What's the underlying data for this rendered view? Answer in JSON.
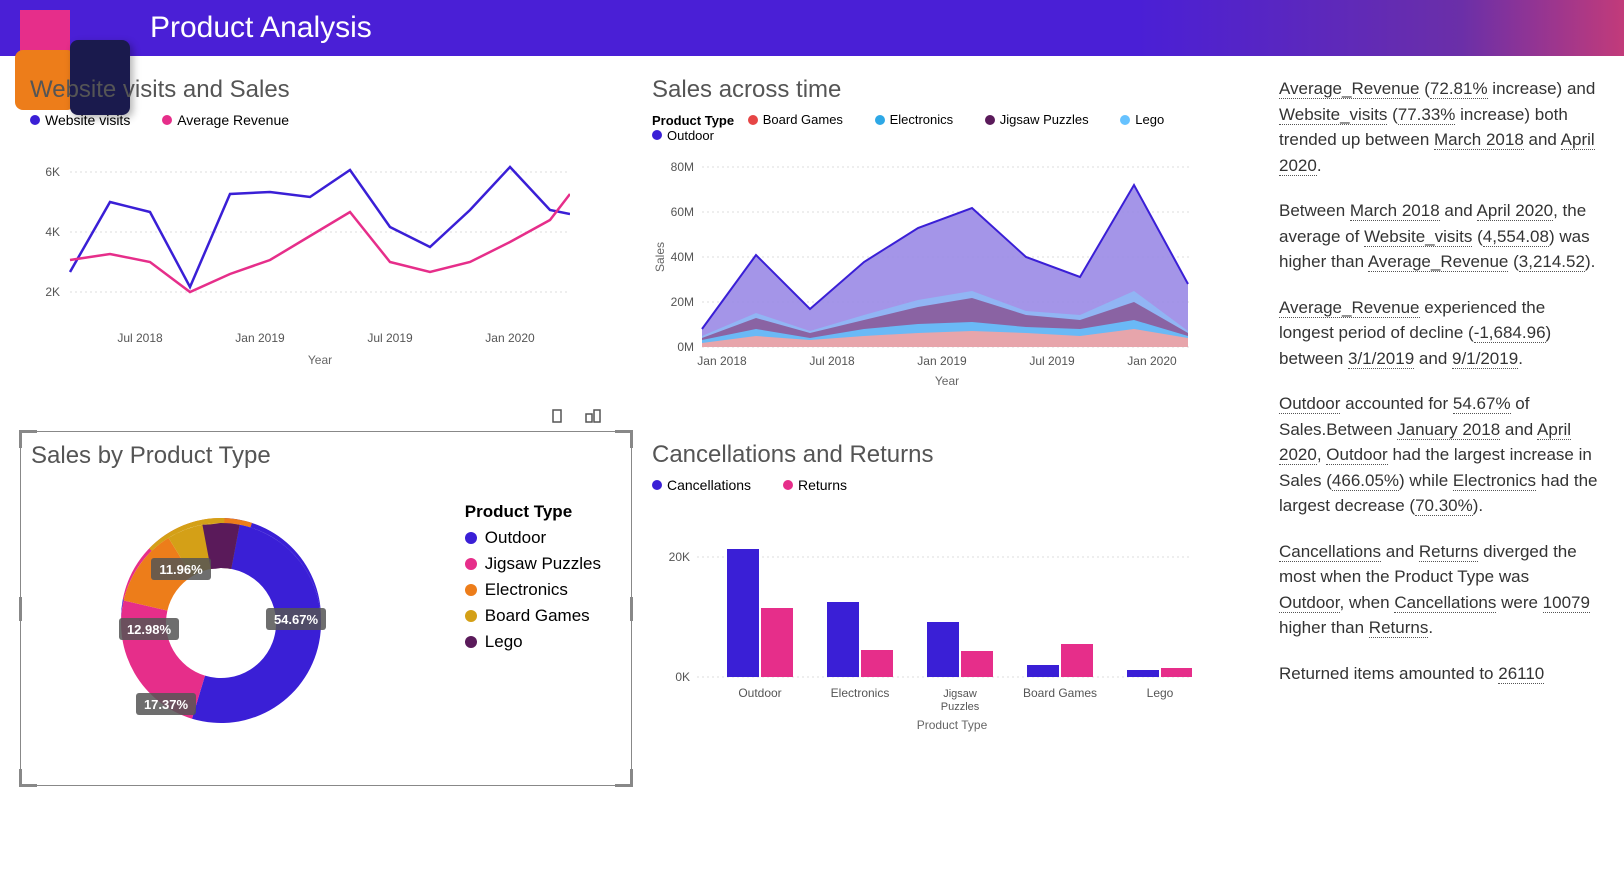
{
  "header": {
    "title": "Product Analysis"
  },
  "colors": {
    "blue": "#3a1fd6",
    "pink": "#e62e8a",
    "orange": "#ed7d1a",
    "gold": "#d4a017",
    "darkpurple": "#5a1a5a",
    "lightblue": "#2ea8e6",
    "violet": "#8a6fe6"
  },
  "visits_sales": {
    "title": "Website visits and Sales",
    "legend": [
      "Website visits",
      "Average Revenue"
    ],
    "xlabel": "Year",
    "y_ticks": [
      "2K",
      "4K",
      "6K"
    ],
    "x_ticks": [
      "Jul 2018",
      "Jan 2019",
      "Jul 2019",
      "Jan 2020"
    ]
  },
  "sales_time": {
    "title": "Sales across time",
    "legend_title": "Product Type",
    "legend": [
      "Board Games",
      "Electronics",
      "Jigsaw Puzzles",
      "Lego",
      "Outdoor"
    ],
    "ylabel": "Sales",
    "xlabel": "Year",
    "y_ticks": [
      "0M",
      "20M",
      "40M",
      "60M",
      "80M"
    ],
    "x_ticks": [
      "Jan 2018",
      "Jul 2018",
      "Jan 2019",
      "Jul 2019",
      "Jan 2020"
    ]
  },
  "sales_product": {
    "title": "Sales by Product Type",
    "legend_title": "Product Type",
    "legend": [
      "Outdoor",
      "Jigsaw Puzzles",
      "Electronics",
      "Board Games",
      "Lego"
    ],
    "labels": [
      "54.67%",
      "17.37%",
      "12.98%",
      "11.96%"
    ]
  },
  "cancel_returns": {
    "title": "Cancellations and Returns",
    "legend": [
      "Cancellations",
      "Returns"
    ],
    "y_ticks": [
      "0K",
      "20K"
    ],
    "xlabel": "Product Type",
    "x_ticks": [
      "Outdoor",
      "Electronics",
      "Jigsaw Puzzles",
      "Board Games",
      "Lego"
    ]
  },
  "narrative": {
    "p1_pre": "",
    "p1_ar": "Average_Revenue",
    "p1_arpct": "72.81%",
    "p1_inc": " increase) and ",
    "p1_wv": "Website_visits",
    "p1_wvpct": "77.33%",
    "p1_mid": " increase) both trended up between ",
    "p1_d1": "March 2018",
    "p1_and": " and ",
    "p1_d2": "April 2020",
    "p2_pre": "Between ",
    "p2_d1": "March 2018",
    "p2_and": " and ",
    "p2_d2": "April 2020",
    "p2_mid": ", the average of ",
    "p2_wv": "Website_visits",
    "p2_wvv": "4,554.08",
    "p2_mid2": ") was higher than ",
    "p2_ar": "Average_Revenue",
    "p2_arv": "3,214.52",
    "p3_ar": "Average_Revenue",
    "p3_txt": " experienced the longest period of decline (",
    "p3_v": "-1,684.96",
    "p3_mid": ") between ",
    "p3_d1": "3/1/2019",
    "p3_and": " and ",
    "p3_d2": "9/1/2019",
    "p4_o": "Outdoor",
    "p4_txt1": " accounted for ",
    "p4_pct": "54.67%",
    "p4_txt2": " of Sales.Between ",
    "p4_d1": "January 2018",
    "p4_and": " and ",
    "p4_d2": "April 2020",
    "p4_txt3": ", ",
    "p4_o2": "Outdoor",
    "p4_txt4": " had the largest increase in Sales (",
    "p4_pct2": "466.05%",
    "p4_txt5": ") while ",
    "p4_e": "Electronics",
    "p4_txt6": " had the largest decrease (",
    "p4_pct3": "70.30%",
    "p5_c": "Cancellations",
    "p5_and": " and ",
    "p5_r": "Returns",
    "p5_txt": " diverged the most when the Product Type was ",
    "p5_o": "Outdoor",
    "p5_txt2": ", when ",
    "p5_c2": "Cancellations",
    "p5_txt3": " were ",
    "p5_v": "10079",
    "p5_txt4": " higher than ",
    "p5_r2": "Returns",
    "p6_txt": "Returned items amounted to ",
    "p6_v": "26110"
  },
  "chart_data": [
    {
      "type": "line",
      "title": "Website visits and Sales",
      "xlabel": "Year",
      "ylabel": "",
      "x": [
        "Mar 2018",
        "May 2018",
        "Jul 2018",
        "Sep 2018",
        "Nov 2018",
        "Jan 2019",
        "Mar 2019",
        "May 2019",
        "Jul 2019",
        "Sep 2019",
        "Nov 2019",
        "Jan 2020",
        "Mar 2020",
        "Apr 2020"
      ],
      "series": [
        {
          "name": "Website visits",
          "values": [
            2700,
            5000,
            4700,
            2200,
            5300,
            5400,
            5200,
            6100,
            4200,
            3500,
            4800,
            6200,
            4800,
            4700
          ]
        },
        {
          "name": "Average Revenue",
          "values": [
            3100,
            3300,
            3000,
            2000,
            2600,
            3100,
            3900,
            4700,
            3000,
            2700,
            3000,
            3700,
            4400,
            5300
          ]
        }
      ],
      "ylim": [
        0,
        6500
      ]
    },
    {
      "type": "area",
      "title": "Sales across time",
      "xlabel": "Year",
      "ylabel": "Sales",
      "x": [
        "Jan 2018",
        "Apr 2018",
        "Jul 2018",
        "Oct 2018",
        "Jan 2019",
        "Apr 2019",
        "Jul 2019",
        "Oct 2019",
        "Jan 2020",
        "Apr 2020"
      ],
      "series": [
        {
          "name": "Board Games",
          "values": [
            2,
            5,
            3,
            5,
            6,
            7,
            6,
            5,
            8,
            4
          ]
        },
        {
          "name": "Electronics",
          "values": [
            3,
            8,
            4,
            8,
            10,
            11,
            9,
            8,
            12,
            5
          ]
        },
        {
          "name": "Jigsaw Puzzles",
          "values": [
            4,
            13,
            6,
            12,
            18,
            22,
            14,
            12,
            20,
            6
          ]
        },
        {
          "name": "Lego",
          "values": [
            5,
            15,
            7,
            14,
            21,
            25,
            16,
            14,
            25,
            7
          ]
        },
        {
          "name": "Outdoor",
          "values": [
            8,
            41,
            17,
            38,
            53,
            62,
            40,
            31,
            72,
            28
          ]
        }
      ],
      "ylim": [
        0,
        80
      ],
      "yunit": "M"
    },
    {
      "type": "pie",
      "title": "Sales by Product Type",
      "series": [
        {
          "name": "Product Type",
          "values": [
            {
              "label": "Outdoor",
              "value": 54.67
            },
            {
              "label": "Jigsaw Puzzles",
              "value": 17.37
            },
            {
              "label": "Electronics",
              "value": 12.98
            },
            {
              "label": "Board Games",
              "value": 11.96
            },
            {
              "label": "Lego",
              "value": 3.02
            }
          ]
        }
      ]
    },
    {
      "type": "bar",
      "title": "Cancellations and Returns",
      "xlabel": "Product Type",
      "ylabel": "",
      "categories": [
        "Outdoor",
        "Electronics",
        "Jigsaw Puzzles",
        "Board Games",
        "Lego"
      ],
      "series": [
        {
          "name": "Cancellations",
          "values": [
            21500,
            12500,
            9000,
            2000,
            1200
          ]
        },
        {
          "name": "Returns",
          "values": [
            11400,
            4500,
            4200,
            5500,
            1500
          ]
        }
      ],
      "ylim": [
        0,
        22000
      ]
    }
  ]
}
